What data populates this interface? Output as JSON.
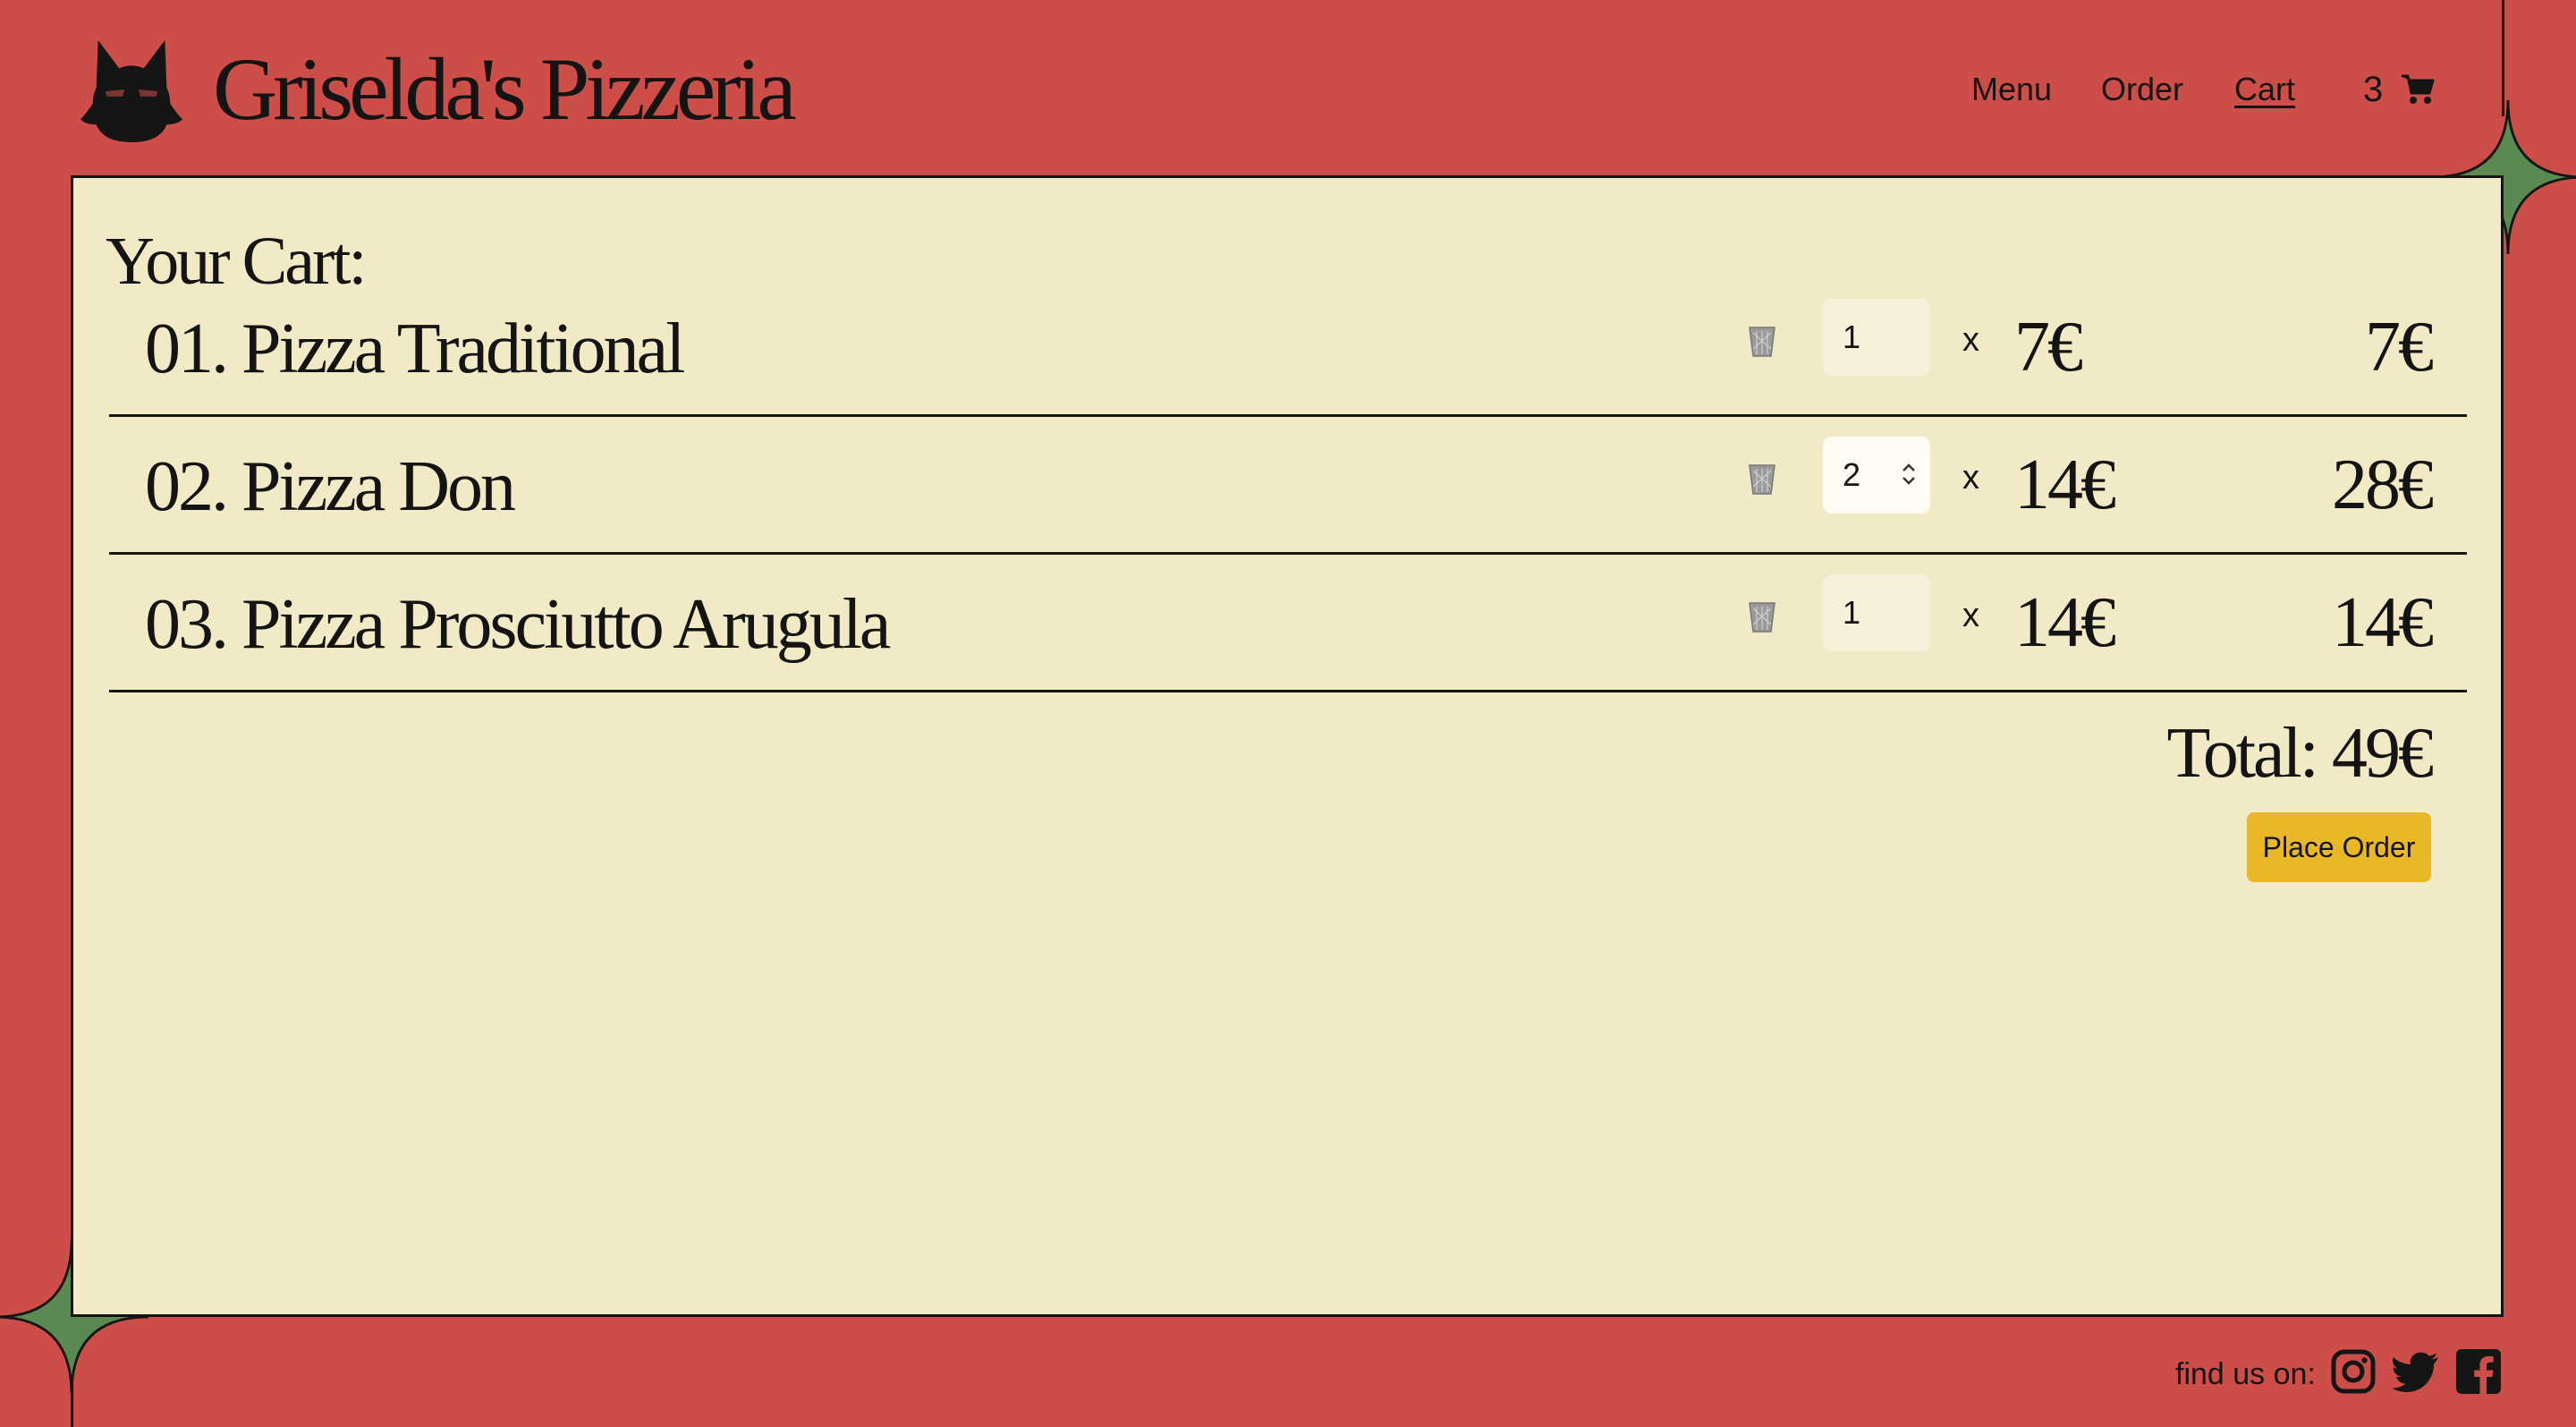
{
  "header": {
    "brand": "Griselda's Pizzeria",
    "logo_icon": "cat-silhouette-icon",
    "nav": [
      {
        "label": "Menu"
      },
      {
        "label": "Order"
      },
      {
        "label": "Cart",
        "active": true
      }
    ],
    "cart_count": "3",
    "cart_icon": "shopping-cart-icon"
  },
  "cart": {
    "title": "Your Cart:",
    "items": [
      {
        "name": "01. Pizza Traditional",
        "qty": "1",
        "times": "x",
        "unit_price": "7€",
        "subtotal": "7€"
      },
      {
        "name": "02. Pizza Don",
        "qty": "2",
        "times": "x",
        "unit_price": "14€",
        "subtotal": "28€"
      },
      {
        "name": "03. Pizza Prosciutto Arugula",
        "qty": "1",
        "times": "x",
        "unit_price": "14€",
        "subtotal": "14€"
      }
    ],
    "total": "Total: 49€",
    "place_order": "Place Order"
  },
  "footer": {
    "find_us": "find us on:",
    "social_icons": [
      "instagram-icon",
      "twitter-icon",
      "facebook-icon"
    ]
  },
  "colors": {
    "background": "#cd4e48",
    "panel": "#f2eac6",
    "accent_green": "#5a8a52",
    "button": "#e9b827",
    "ink": "#141414"
  }
}
